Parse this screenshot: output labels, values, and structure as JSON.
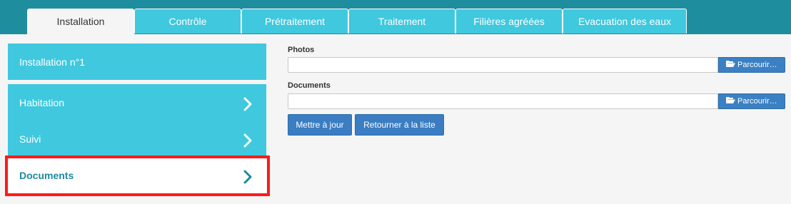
{
  "tabs": [
    {
      "label": "Installation",
      "active": true
    },
    {
      "label": "Contrôle"
    },
    {
      "label": "Prétraitement"
    },
    {
      "label": "Traitement"
    },
    {
      "label": "Filières agréées"
    },
    {
      "label": "Evacuation des eaux"
    }
  ],
  "sidebar": {
    "header": "Installation n°1",
    "items": [
      {
        "label": "Habitation"
      },
      {
        "label": "Suivi"
      },
      {
        "label": "Documents",
        "active": true
      }
    ]
  },
  "form": {
    "photos_label": "Photos",
    "photos_value": "",
    "documents_label": "Documents",
    "documents_value": "",
    "browse_label": "Parcourir…"
  },
  "actions": {
    "update_label": "Mettre à jour",
    "back_label": "Retourner à la liste"
  },
  "colors": {
    "topbar": "#1e8e9f",
    "tab": "#3fc8de",
    "sidebar": "#3fc8de",
    "primary": "#3b7dc3",
    "highlight": "#ff1a1a"
  }
}
